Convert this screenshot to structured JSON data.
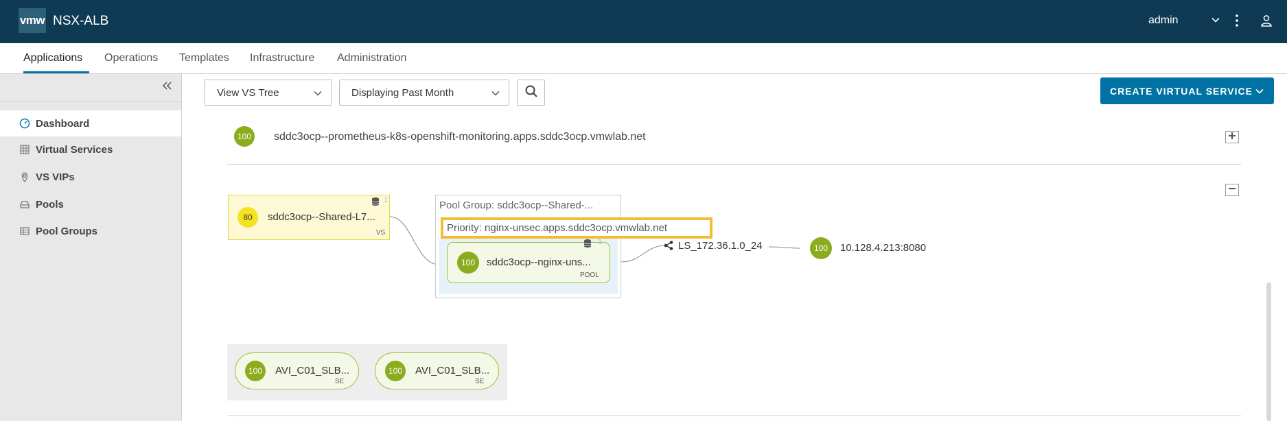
{
  "header": {
    "logo": "vmw",
    "title": "NSX-ALB",
    "user": "admin"
  },
  "nav": {
    "tabs": [
      "Applications",
      "Operations",
      "Templates",
      "Infrastructure",
      "Administration"
    ],
    "active": "Applications"
  },
  "sidebar": {
    "items": [
      {
        "label": "Dashboard",
        "icon": "dashboard-icon",
        "active": true
      },
      {
        "label": "Virtual Services",
        "icon": "grid-icon",
        "active": false
      },
      {
        "label": "VS VIPs",
        "icon": "pin-icon",
        "active": false
      },
      {
        "label": "Pools",
        "icon": "tray-icon",
        "active": false
      },
      {
        "label": "Pool Groups",
        "icon": "table-icon",
        "active": false
      }
    ]
  },
  "toolbar": {
    "view_select": "View VS Tree",
    "time_select": "Displaying Past Month",
    "create_button": "CREATE VIRTUAL SERVICE"
  },
  "tree": {
    "collapsed_row": {
      "health": "100",
      "name": "sddc3ocp--prometheus-k8s-openshift-monitoring.apps.sddc3ocp.vmwlab.net"
    },
    "vs": {
      "health": "80",
      "name": "sddc3ocp--Shared-L7...",
      "type": "VS",
      "count": "1"
    },
    "pool_group": {
      "title": "Pool Group: sddc3ocp--Shared-...",
      "priority": "Priority: nginx-unsec.apps.sddc3ocp.vmwlab.net"
    },
    "pool": {
      "health": "100",
      "name": "sddc3ocp--nginx-uns...",
      "type": "POOL",
      "count": "1"
    },
    "network": {
      "name": "LS_172.36.1.0_24"
    },
    "server": {
      "health": "100",
      "address": "10.128.4.213:8080"
    },
    "service_engines": [
      {
        "health": "100",
        "name": "AVI_C01_SLB...",
        "type": "SE"
      },
      {
        "health": "100",
        "name": "AVI_C01_SLB...",
        "type": "SE"
      }
    ]
  },
  "colors": {
    "header_bg": "#0f3a54",
    "accent": "#0072a3",
    "health_green": "#8aac1d",
    "health_yellow": "#f3e321",
    "highlight": "#f2bd32"
  }
}
